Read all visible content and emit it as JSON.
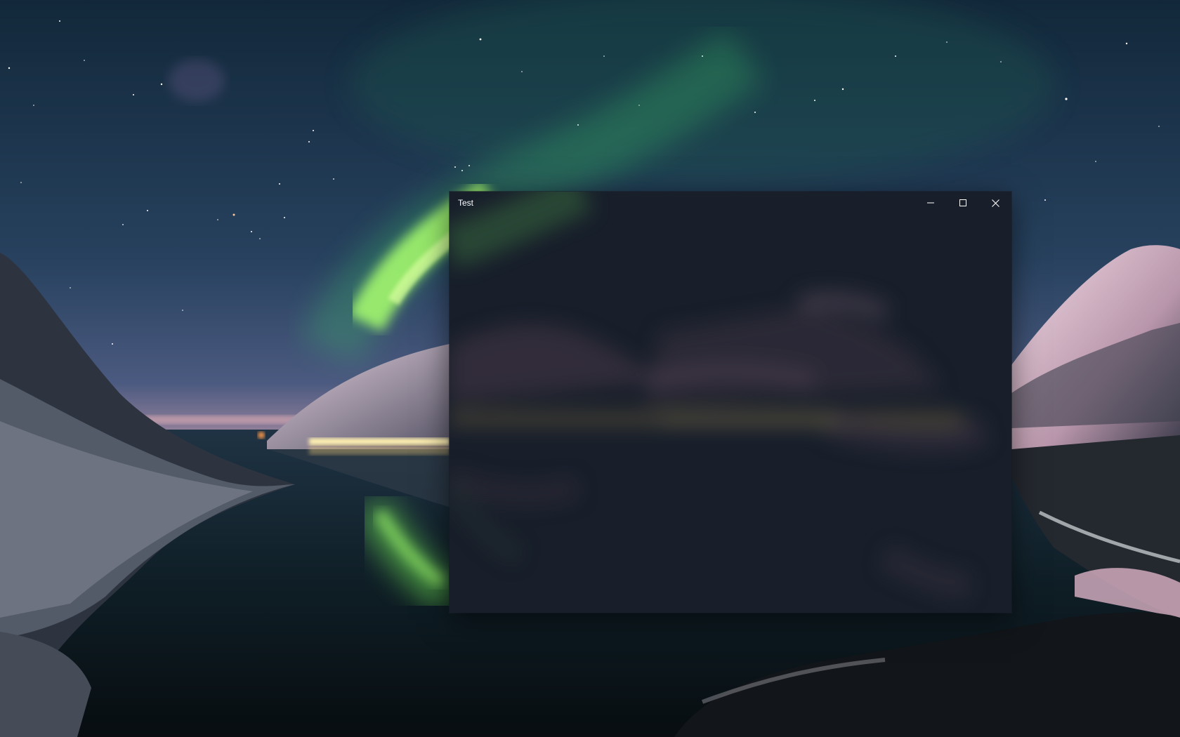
{
  "window": {
    "title": "Test"
  },
  "caption_buttons": {
    "minimize_icon": "minimize-icon",
    "maximize_icon": "maximize-icon",
    "close_icon": "close-icon"
  },
  "colors": {
    "caption_glyph": "#ffffff",
    "acrylic_tint": "#1a2230",
    "aurora": "#7cff5a",
    "sky_top": "#12283a",
    "sky_horizon": "#5a6a8e"
  }
}
